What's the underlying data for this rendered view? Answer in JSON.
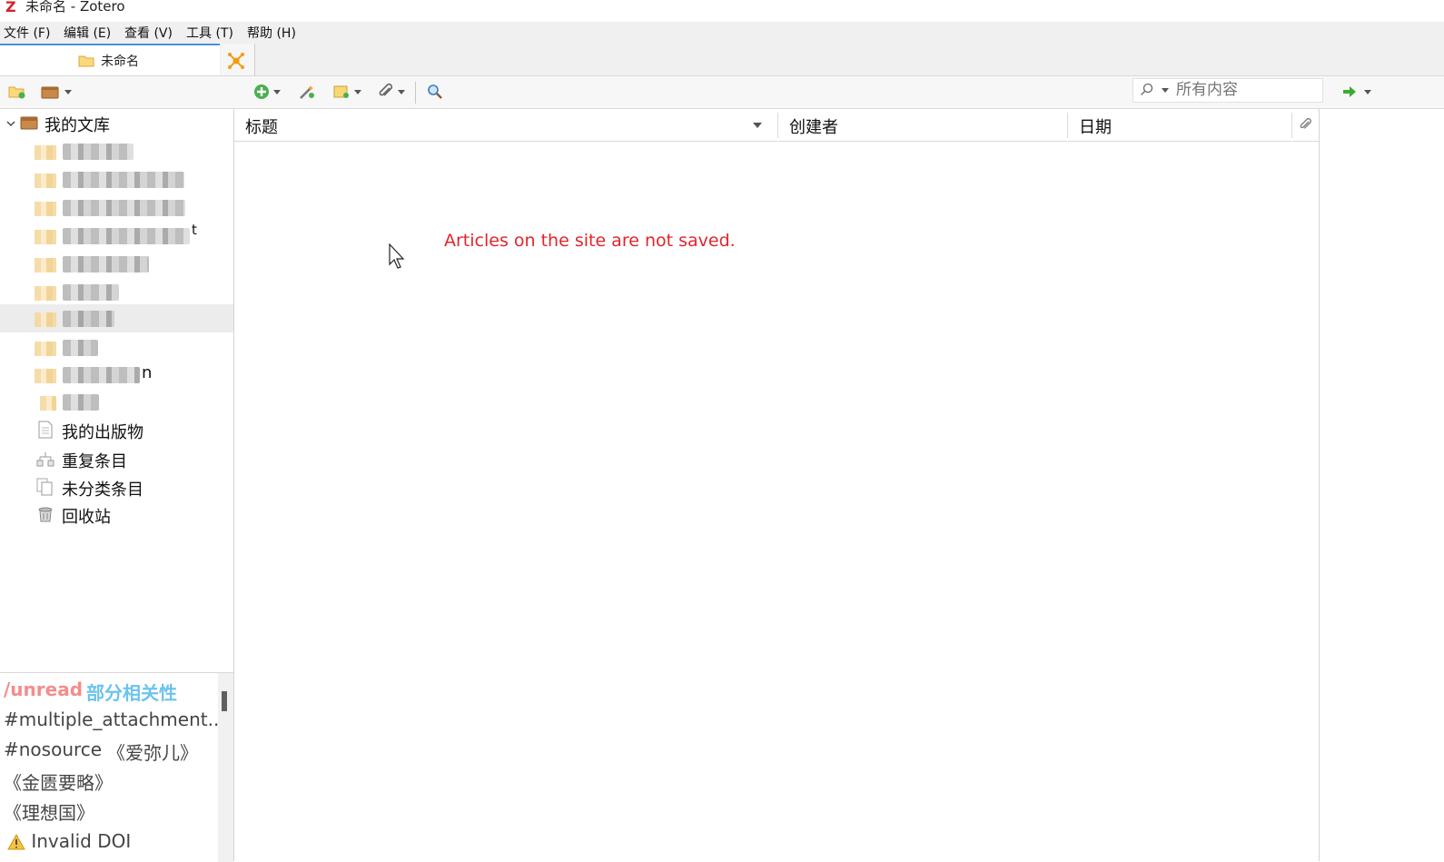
{
  "window": {
    "title": "未命名 - Zotero"
  },
  "menu": [
    "文件 (F)",
    "编辑 (E)",
    "查看 (V)",
    "工具 (T)",
    "帮助 (H)"
  ],
  "tabs": {
    "library_tab": "未命名"
  },
  "search": {
    "placeholder": "所有内容"
  },
  "library": {
    "root": "我的文库",
    "special": [
      "我的出版物",
      "重复条目",
      "未分类条目",
      "回收站"
    ],
    "partial_visible": {
      "row4_suffix": "t",
      "row9_suffix": "n"
    }
  },
  "columns": {
    "title": "标题",
    "creator": "创建者",
    "date": "日期"
  },
  "notice": "Articles on the site are not saved.",
  "tags": [
    "/unread",
    "部分相关性",
    "#multiple_attachment...",
    "#nosource",
    "《爱弥儿》",
    "《金匮要略》",
    "《理想国》",
    "Invalid DOI"
  ],
  "colors": {
    "tag_unread": "#f58c8c",
    "tag_relevance": "#6cc3ec",
    "notice": "#e3242b"
  }
}
